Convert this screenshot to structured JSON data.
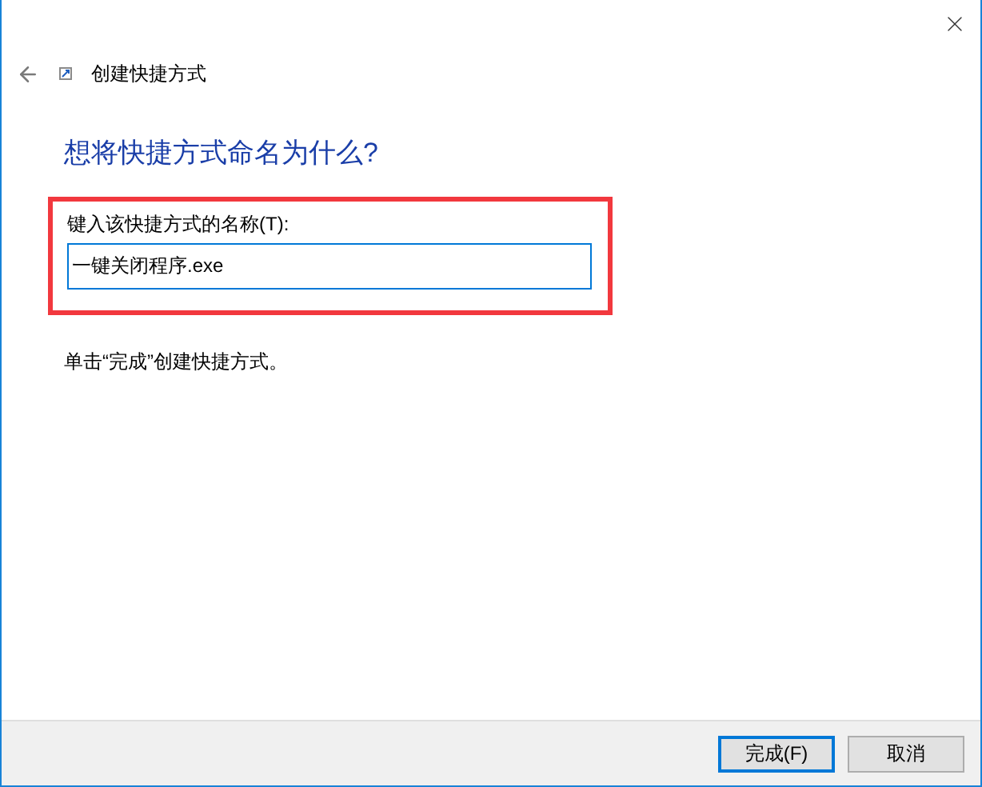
{
  "window": {
    "title": "创建快捷方式"
  },
  "heading": "想将快捷方式命名为什么?",
  "name_field": {
    "label": "键入该快捷方式的名称(T):",
    "value": "一键关闭程序.exe",
    "highlighted": true
  },
  "instruction": "单击“完成”创建快捷方式。",
  "buttons": [
    {
      "label": "完成(F)",
      "default": true
    },
    {
      "label": "取消",
      "default": false
    }
  ]
}
